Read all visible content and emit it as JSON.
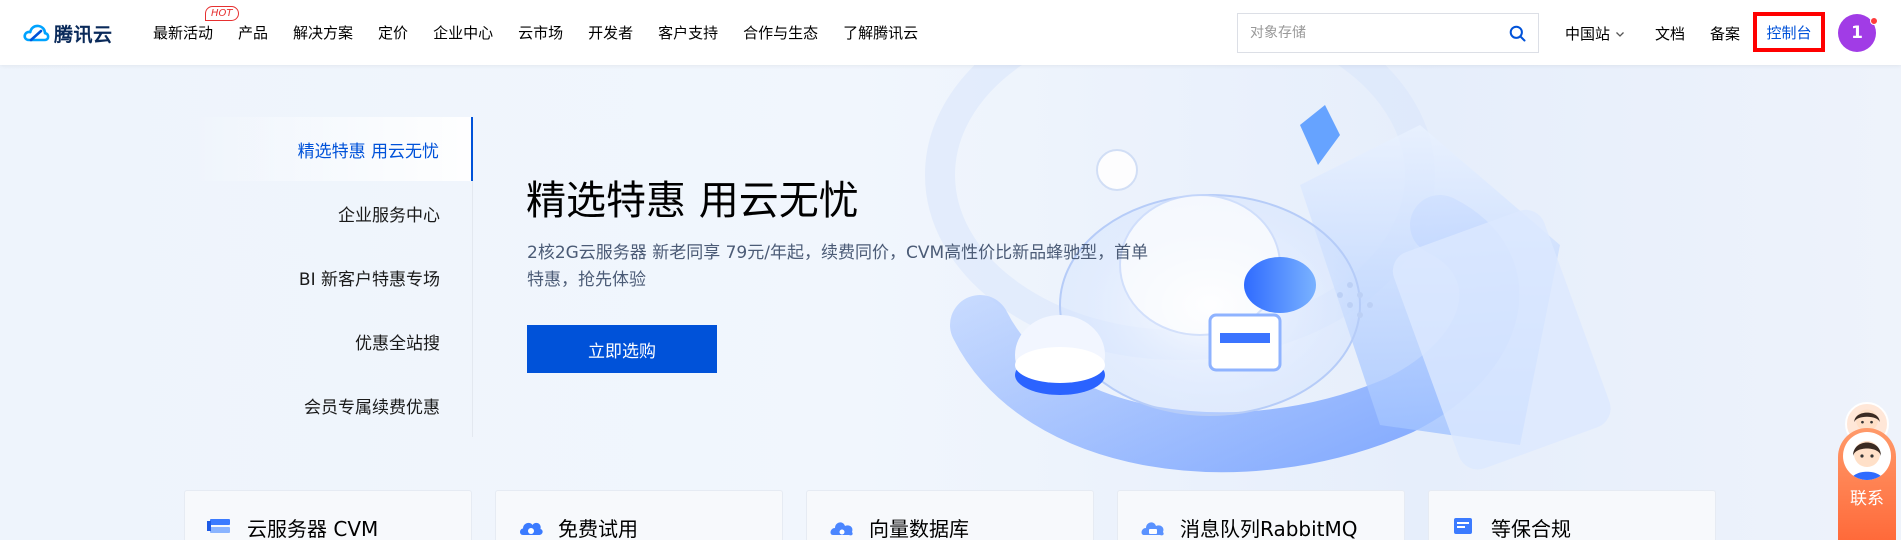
{
  "header": {
    "brand": "腾讯云",
    "nav": [
      {
        "label": "最新活动",
        "badge": "HOT"
      },
      {
        "label": "产品"
      },
      {
        "label": "解决方案"
      },
      {
        "label": "定价"
      },
      {
        "label": "企业中心"
      },
      {
        "label": "云市场"
      },
      {
        "label": "开发者"
      },
      {
        "label": "客户支持"
      },
      {
        "label": "合作与生态"
      },
      {
        "label": "了解腾讯云"
      }
    ],
    "search_placeholder": "对象存储",
    "region": "中国站",
    "docs": "文档",
    "beian": "备案",
    "console": "控制台",
    "avatar_initial": "1"
  },
  "hero": {
    "side_menu": [
      "精选特惠 用云无忧",
      "企业服务中心",
      "BI 新客户特惠专场",
      "优惠全站搜",
      "会员专属续费优惠"
    ],
    "title": "精选特惠 用云无忧",
    "description": "2核2G云服务器 新老同享 79元/年起，续费同价，CVM高性价比新品蜂驰型，首单特惠，抢先体验",
    "cta": "立即选购"
  },
  "cards": [
    {
      "label": "云服务器 CVM",
      "icon": "server-icon"
    },
    {
      "label": "免费试用",
      "icon": "cloud-trial-icon"
    },
    {
      "label": "向量数据库",
      "icon": "vector-db-icon"
    },
    {
      "label": "消息队列RabbitMQ",
      "icon": "message-queue-icon"
    },
    {
      "label": "等保合规",
      "icon": "compliance-icon"
    }
  ],
  "contact": {
    "text": "联系"
  },
  "colors": {
    "primary": "#0052d9",
    "highlight_border": "#ff0000",
    "avatar": "#a13ce6",
    "hot": "#e63030",
    "contact": "#ff6a3a"
  }
}
